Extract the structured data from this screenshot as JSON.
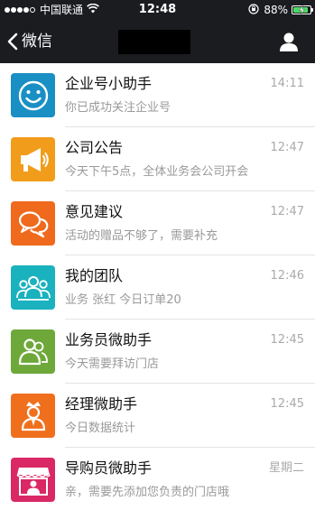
{
  "status_bar": {
    "carrier": "中国联通",
    "time": "12:48",
    "battery": "88%",
    "battery_level": 0.88,
    "signal_bars": 4,
    "signal_total": 5
  },
  "nav_bar": {
    "back_label": "微信",
    "back_icon": "chevron-left-icon",
    "profile_icon": "person-icon"
  },
  "chats": [
    {
      "name": "企业号小助手",
      "time": "14:11",
      "preview": "你已成功关注企业号",
      "icon": "smiley-icon",
      "color": "#1a8fc4"
    },
    {
      "name": "公司公告",
      "time": "12:47",
      "preview": "今天下午5点，全体业务会公司开会",
      "icon": "megaphone-icon",
      "color": "#f19c1b"
    },
    {
      "name": "意见建议",
      "time": "12:47",
      "preview": "活动的赠品不够了，需要补充",
      "icon": "chat-bubbles-icon",
      "color": "#ef6a1d"
    },
    {
      "name": "我的团队",
      "time": "12:46",
      "preview": "业务 张红 今日订单20",
      "icon": "team-icon",
      "color": "#1ab2be"
    },
    {
      "name": "业务员微助手",
      "time": "12:45",
      "preview": "今天需要拜访门店",
      "icon": "salesperson-icon",
      "color": "#6ea83a"
    },
    {
      "name": "经理微助手",
      "time": "12:45",
      "preview": "今日数据统计",
      "icon": "manager-icon",
      "color": "#f06f1d"
    },
    {
      "name": "导购员微助手",
      "time": "星期二",
      "preview": "亲，需要先添加您负责的门店哦",
      "icon": "shop-guide-icon",
      "color": "#d92865"
    }
  ],
  "colors": {
    "header_bg": "#1b1c20",
    "divider": "#e3e3e3",
    "time_text": "#aaaaaa",
    "preview_text": "#999999"
  }
}
